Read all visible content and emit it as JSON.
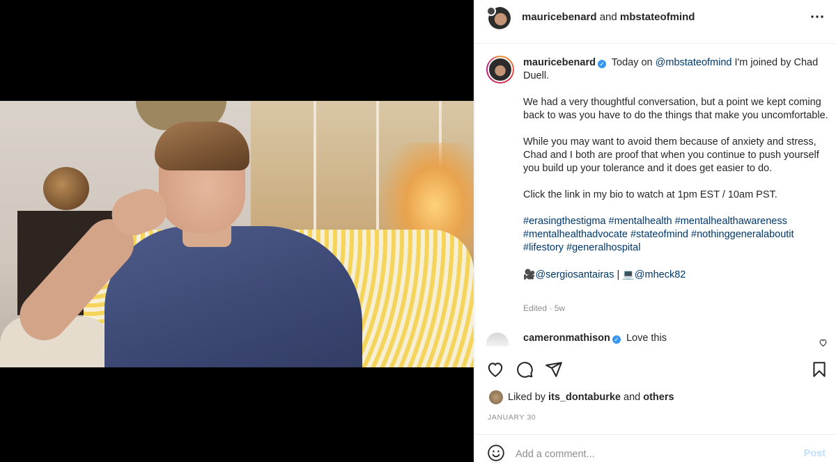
{
  "header": {
    "author": "mauricebenard",
    "joiner": "and",
    "coauthor": "mbstateofmind",
    "more_icon": "more-horizontal-icon"
  },
  "caption": {
    "username": "mauricebenard",
    "verified_icon": "verified-badge-icon",
    "line1_pre": "Today on",
    "line1_mention": "@mbstateofmind",
    "line1_post": "I'm joined by Chad Duell.",
    "para2": "We had a very thoughtful conversation, but a point we kept coming back to was you have to do the things that make you uncomfortable.",
    "para3": "While you may want to avoid them because of anxiety and stress, Chad and I both are proof that when you continue to push yourself you build up your tolerance and it does get easier to do.",
    "para4": "Click the link in my bio to watch at 1pm EST / 10am PST.",
    "hashtags": "#erasingthestigma #mentalhealth #mentalhealthawareness #mentalhealthadvocate #stateofmind #nothinggeneralaboutit #lifestory #generalhospital",
    "credit1_emoji": "🎥",
    "credit1": "@sergiosantairas",
    "separator": "|",
    "credit2_emoji": "💻",
    "credit2": "@mheck82",
    "edited": "Edited · 5w"
  },
  "comment": {
    "username": "cameronmathison",
    "text": "Love this",
    "like_icon": "heart-outline-icon"
  },
  "actions": {
    "like_icon": "heart-outline-icon",
    "comment_icon": "comment-bubble-icon",
    "share_icon": "paper-plane-icon",
    "save_icon": "bookmark-icon"
  },
  "likes": {
    "prefix": "Liked by",
    "user": "its_dontaburke",
    "and": "and",
    "others": "others"
  },
  "date": "JANUARY 30",
  "comment_bar": {
    "placeholder": "Add a comment...",
    "post_label": "Post",
    "emoji_icon": "smiley-icon"
  }
}
